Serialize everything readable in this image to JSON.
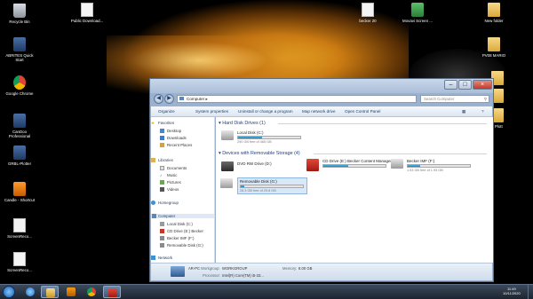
{
  "desktop_icons": [
    {
      "label": "Recycle Bin",
      "icon": "recycle-bin-icon"
    },
    {
      "label": "ABRITES Quick Start",
      "icon": "app-icon"
    },
    {
      "label": "Google Chrome",
      "icon": "chrome-icon"
    },
    {
      "label": "CanDoo Professional",
      "icon": "app-icon"
    },
    {
      "label": "GRBL-Plotter",
      "icon": "app-icon"
    },
    {
      "label": "Candle - Shortcut",
      "icon": "candle-icon"
    },
    {
      "label": "ScreenReco...",
      "icon": "document-icon"
    },
    {
      "label": "ScreenReco...",
      "icon": "document-icon"
    },
    {
      "label": "Public Download...",
      "icon": "document-icon"
    },
    {
      "label": "becker 20",
      "icon": "document-icon"
    },
    {
      "label": "Movavi Screen ...",
      "icon": "movavi-icon"
    },
    {
      "label": "New folder",
      "icon": "folder-icon"
    },
    {
      "label": "PV08 MARIO",
      "icon": "folder-icon"
    },
    {
      "label": "",
      "icon": "folder-icon"
    },
    {
      "label": "",
      "icon": "folder-icon"
    },
    {
      "label": "- Plott",
      "icon": "folder-icon"
    }
  ],
  "window": {
    "address": "Computer",
    "search_placeholder": "Search Computer",
    "commands": [
      "Organize",
      "System properties",
      "Uninstall or change a program",
      "Map network drive",
      "Open Control Panel"
    ],
    "nav": {
      "favorites": "Favorites",
      "favorites_items": [
        "Desktop",
        "Downloads",
        "Recent Places"
      ],
      "libraries": "Libraries",
      "libraries_items": [
        "Documents",
        "Music",
        "Pictures",
        "Videos"
      ],
      "homegroup": "Homegroup",
      "computer": "Computer",
      "computer_items": [
        "Local Disk (C:)",
        "CD Drive (E:) Becker",
        "Becker IMF (F:)",
        "Removable Disk (G:)"
      ],
      "network": "Network"
    },
    "hard_disk_group": "Hard Disk Drives (1)",
    "removable_group": "Devices with Removable Storage (4)",
    "drives": {
      "local_c": {
        "name": "Local Disk (C:)",
        "free": "290 GB free of 465 GB",
        "used_fraction": 0.38
      },
      "dvd_d": {
        "name": "DVD RW Drive (D:)"
      },
      "cd_e": {
        "name": "CD Drive (E:) Becker Content Manager",
        "used_fraction": 0.4
      },
      "becker_f": {
        "name": "Becker IMF (F:)",
        "free": "1.53 GB free of 1.93 GB",
        "used_fraction": 0.2
      },
      "removable_g": {
        "name": "Removable Disk (G:)",
        "free": "28.3 GB free of 29.8 GB",
        "used_fraction": 0.06
      }
    },
    "details": {
      "pc_name": "AR-PC",
      "workgroup_label": "Workgroup:",
      "workgroup_value": "WORKGROUP",
      "memory_label": "Memory:",
      "memory_value": "8.00 GB",
      "processor_label": "Processor:",
      "processor_value": "Intel(R) Core(TM) i5-33..."
    }
  },
  "taskbar": {
    "time": "11:49",
    "date": "10/11/2020"
  },
  "colors": {
    "accent": "#1e3f8a",
    "progress": "#26a0da",
    "taskbar": "#1c2430"
  }
}
